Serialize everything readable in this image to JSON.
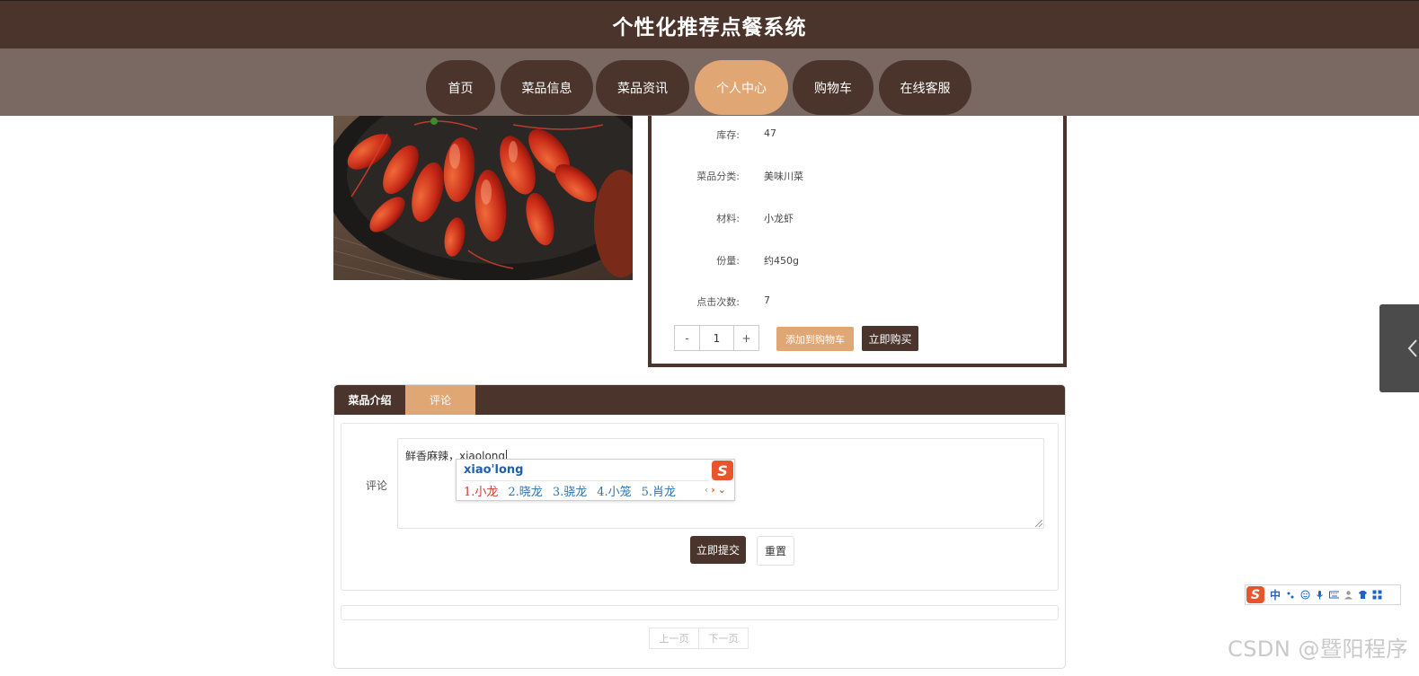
{
  "header": {
    "title": "个性化推荐点餐系统"
  },
  "nav": {
    "items": [
      {
        "label": "首页"
      },
      {
        "label": "菜品信息"
      },
      {
        "label": "菜品资讯"
      },
      {
        "label": "个人中心",
        "active": true
      },
      {
        "label": "购物车"
      },
      {
        "label": "在线客服"
      }
    ]
  },
  "product": {
    "image_icon": "crayfish-dish-photo",
    "details": [
      {
        "label": "库存:",
        "value": "47"
      },
      {
        "label": "菜品分类:",
        "value": "美味川菜"
      },
      {
        "label": "材料:",
        "value": "小龙虾"
      },
      {
        "label": "份量:",
        "value": "约450g"
      },
      {
        "label": "点击次数:",
        "value": "7"
      }
    ],
    "quantity": {
      "minus": "-",
      "value": "1",
      "plus": "+"
    },
    "add_to_cart_label": "添加到购物车",
    "buy_now_label": "立即购买"
  },
  "tabs": {
    "items": [
      {
        "label": "菜品介绍"
      },
      {
        "label": "评论",
        "active": true
      }
    ]
  },
  "comment": {
    "label": "评论",
    "text": "鲜香麻辣，xiaolong",
    "submit_label": "立即提交",
    "reset_label": "重置"
  },
  "ime": {
    "pinyin": "xiao'long",
    "candidates": [
      "1.小龙",
      "2.晓龙",
      "3.骁龙",
      "4.小笼",
      "5.肖龙"
    ],
    "logo": "S",
    "toolbar_mode": "中"
  },
  "pagination": {
    "prev": "上一页",
    "next": "下一页"
  },
  "watermark": "CSDN @暨阳程序",
  "colors": {
    "brand_dark": "#4a342b",
    "accent": "#e0a673",
    "nav_bg": "#7a6962"
  }
}
